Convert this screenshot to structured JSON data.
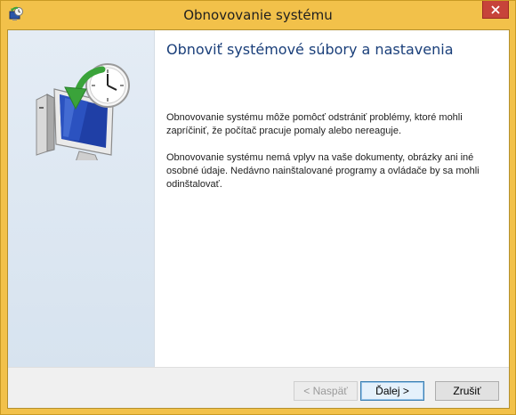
{
  "window": {
    "title": "Obnovovanie systému"
  },
  "main": {
    "heading": "Obnoviť systémové súbory a nastavenia",
    "paragraph1": "Obnovovanie systému môže pomôcť odstrániť problémy, ktoré mohli zapríčiniť, že počítač pracuje pomaly alebo nereaguje.",
    "paragraph2": "Obnovovanie systému nemá vplyv na vaše dokumenty, obrázky ani iné osobné údaje. Nedávno nainštalované programy a ovládače by sa mohli odinštalovať."
  },
  "footer": {
    "back_label": "< Naspäť",
    "next_label": "Ďalej >",
    "cancel_label": "Zrušiť"
  },
  "icons": {
    "title_icon": "system-restore-icon",
    "hero_icon": "system-restore-computer-clock-icon",
    "close_icon": "close-icon"
  },
  "colors": {
    "titlebar": "#f2c14a",
    "close_button": "#c7433a",
    "heading": "#1a3f7a",
    "left_pane": "#e4ecf5"
  }
}
